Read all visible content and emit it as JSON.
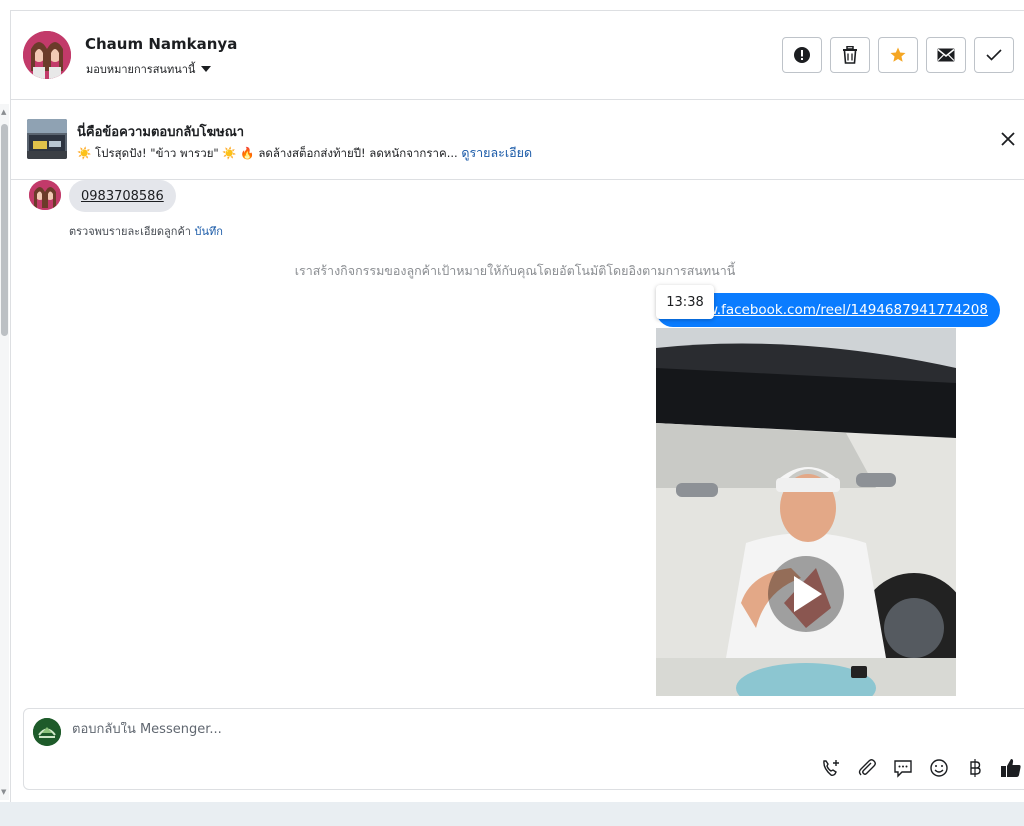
{
  "header": {
    "contact_name": "Chaum Namkanya",
    "assign_label": "มอบหมายการสนทนานี้",
    "actions": [
      {
        "name": "spam",
        "icon": "exclamation-circle-icon"
      },
      {
        "name": "delete",
        "icon": "trash-icon"
      },
      {
        "name": "star",
        "icon": "star-icon",
        "color": "#f5a623"
      },
      {
        "name": "unread",
        "icon": "envelope-icon"
      },
      {
        "name": "done",
        "icon": "checkmark-icon"
      }
    ]
  },
  "banner": {
    "title": "นี่คือข้อความตอบกลับโฆษณา",
    "subtitle": "☀️ โปรสุดปัง! \"ข้าว พารวย\" ☀️ 🔥 ลดล้างสต็อกส่งท้ายปี! ลดหนักจากราค...",
    "link": "ดูรายละเอียด"
  },
  "messages": {
    "phone": "0983708586",
    "detect_note": "ตรวจพบรายละเอียดลูกค้า",
    "detect_action": "บันทึก",
    "system_note": "เราสร้างกิจกรรมของลูกค้าเป้าหมายให้กับคุณโดยอัตโนมัติโดยอิงตามการสนทนานี้",
    "link_text": "www.facebook.com/reel/1494687941774208",
    "time": "13:38"
  },
  "composer": {
    "placeholder": "ตอบกลับใน Messenger...",
    "tools": [
      "phone-plus-icon",
      "paperclip-icon",
      "chat-bubble-icon",
      "smile-icon",
      "baht-icon",
      "thumbs-up-icon"
    ]
  },
  "colors": {
    "accent": "#0a7cff",
    "link": "#1a5aa8",
    "star": "#f5a623"
  }
}
